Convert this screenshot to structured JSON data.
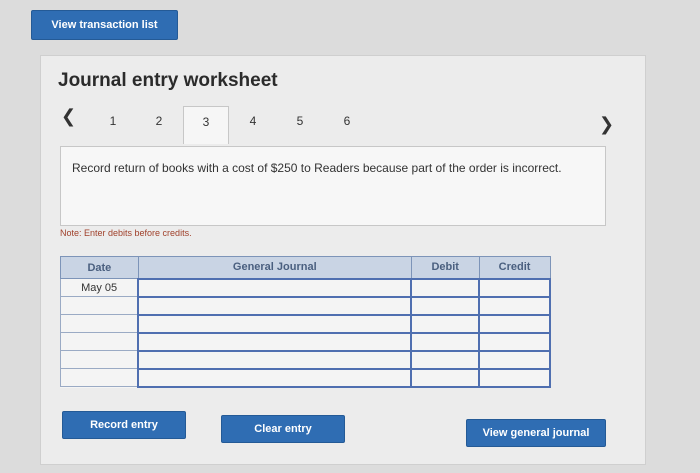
{
  "top_button": {
    "label": "View transaction list"
  },
  "worksheet": {
    "title": "Journal entry worksheet",
    "prev_icon": "chevron-left-icon",
    "next_icon": "chevron-right-icon",
    "tabs": [
      {
        "label": "1"
      },
      {
        "label": "2"
      },
      {
        "label": "3"
      },
      {
        "label": "4"
      },
      {
        "label": "5"
      },
      {
        "label": "6"
      }
    ],
    "active_tab": "3",
    "instruction": "Record return of books with a cost of $250 to Readers because part of the order is incorrect.",
    "note": "Note: Enter debits before credits."
  },
  "journal": {
    "headers": {
      "date": "Date",
      "general_journal": "General Journal",
      "debit": "Debit",
      "credit": "Credit"
    },
    "rows": [
      {
        "date": "May 05",
        "account": "",
        "debit": "",
        "credit": ""
      },
      {
        "date": "",
        "account": "",
        "debit": "",
        "credit": ""
      },
      {
        "date": "",
        "account": "",
        "debit": "",
        "credit": ""
      },
      {
        "date": "",
        "account": "",
        "debit": "",
        "credit": ""
      },
      {
        "date": "",
        "account": "",
        "debit": "",
        "credit": ""
      },
      {
        "date": "",
        "account": "",
        "debit": "",
        "credit": ""
      }
    ]
  },
  "actions": {
    "record_label": "Record entry",
    "clear_label": "Clear entry",
    "view_gj_label": "View general journal"
  }
}
